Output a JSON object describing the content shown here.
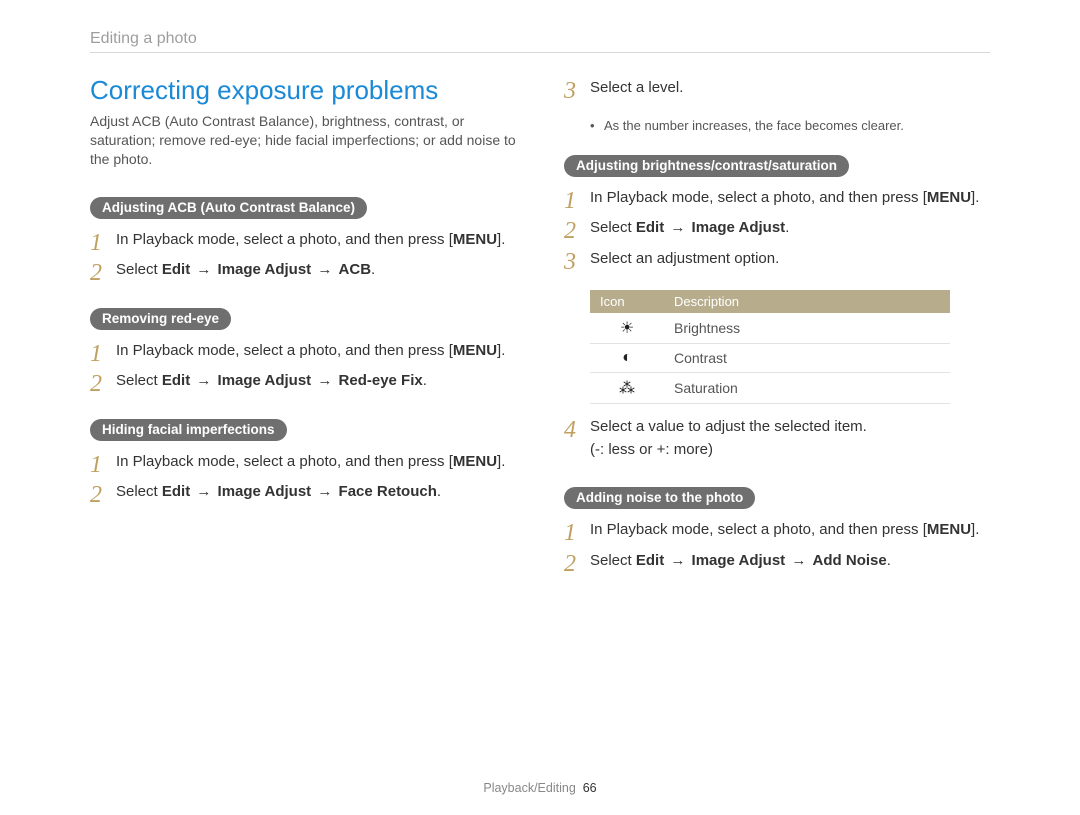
{
  "breadcrumb": "Editing a photo",
  "heading": "Correcting exposure problems",
  "intro": "Adjust ACB (Auto Contrast Balance), brightness, contrast, or saturation; remove red-eye; hide facial imperfections; or add noise to the photo.",
  "menu_label": "MENU",
  "arrow": "→",
  "left": {
    "acb": {
      "title": "Adjusting ACB (Auto Contrast Balance)",
      "s1a": "In Playback mode, select a photo, and then press ",
      "s1b": ".",
      "s2a": "Select ",
      "s2b": "Edit",
      "s2c": "Image Adjust",
      "s2d": "ACB",
      "s2e": "."
    },
    "redeye": {
      "title": "Removing red-eye",
      "s1a": "In Playback mode, select a photo, and then press ",
      "s1b": ".",
      "s2a": "Select ",
      "s2b": "Edit",
      "s2c": "Image Adjust",
      "s2d": "Red-eye Fix",
      "s2e": "."
    },
    "face": {
      "title": "Hiding facial imperfections",
      "s1a": "In Playback mode, select a photo, and then press ",
      "s1b": ".",
      "s2a": "Select ",
      "s2b": "Edit",
      "s2c": "Image Adjust",
      "s2d": "Face Retouch",
      "s2e": "."
    }
  },
  "right": {
    "cont_face": {
      "s3": "Select a level.",
      "note": "As the number increases, the face becomes clearer."
    },
    "bcs": {
      "title": "Adjusting brightness/contrast/saturation",
      "s1a": "In Playback mode, select a photo, and then press ",
      "s1b": ".",
      "s2a": "Select ",
      "s2b": "Edit",
      "s2c": "Image Adjust",
      "s2d": ".",
      "s3": "Select an adjustment option.",
      "table": {
        "h1": "Icon",
        "h2": "Description",
        "r1": {
          "icon": "☀",
          "label": "Brightness"
        },
        "r2": {
          "icon": "◐",
          "label": "Contrast"
        },
        "r3": {
          "icon": "⁂",
          "label": "Saturation"
        }
      },
      "s4a": "Select a value to adjust the selected item.",
      "s4b": "(-: less or +: more)"
    },
    "noise": {
      "title": "Adding noise to the photo",
      "s1a": "In Playback mode, select a photo, and then press ",
      "s1b": ".",
      "s2a": "Select ",
      "s2b": "Edit",
      "s2c": "Image Adjust",
      "s2d": "Add Noise",
      "s2e": "."
    }
  },
  "footer": {
    "section": "Playback/Editing",
    "page": "66"
  }
}
